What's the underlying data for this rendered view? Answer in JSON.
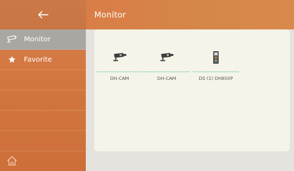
{
  "header": {
    "title": "Monitor"
  },
  "sidebar": {
    "back_icon": "arrow-left-icon",
    "home_icon": "home-icon",
    "items": [
      {
        "label": "Monitor",
        "icon": "cctv-camera-icon",
        "active": true
      },
      {
        "label": "Favorite",
        "icon": "star-icon",
        "active": false
      }
    ]
  },
  "devices": [
    {
      "label": "DH-CAM",
      "icon": "cctv-camera-icon"
    },
    {
      "label": "DH-CAM",
      "icon": "cctv-camera-icon"
    },
    {
      "label": "DS (1) DH850P",
      "icon": "door-station-icon"
    }
  ],
  "colors": {
    "accent": "#D9804D",
    "active_item": "#A9A7A1",
    "panel": "#F4F4E9",
    "divider": "#A3D6C0"
  }
}
